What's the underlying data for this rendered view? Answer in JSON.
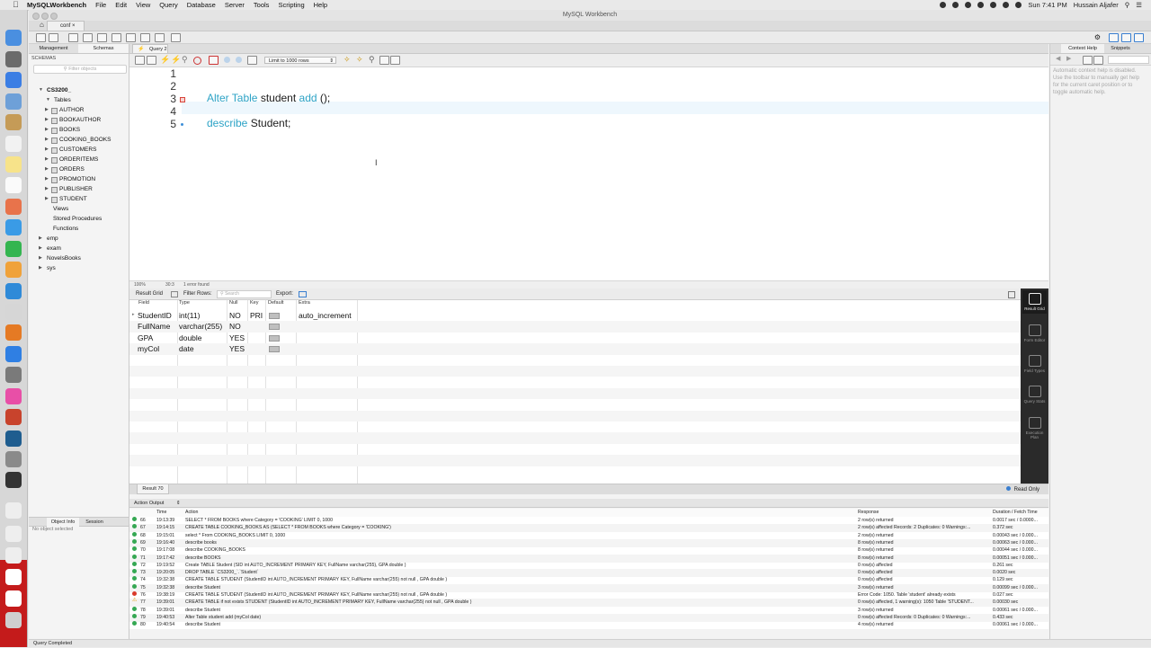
{
  "menubar": {
    "app": "MySQLWorkbench",
    "items": [
      "File",
      "Edit",
      "View",
      "Query",
      "Database",
      "Server",
      "Tools",
      "Scripting",
      "Help"
    ],
    "clock": "Sun 7:41 PM",
    "user": "Hussain Aljafer"
  },
  "window": {
    "title": "MySQL Workbench",
    "connection_tab": "conf"
  },
  "sidebar": {
    "tabs": [
      "Management",
      "Schemas"
    ],
    "header": "SCHEMAS",
    "filter_placeholder": "Filter objects",
    "schema": "CS3200_",
    "tables_label": "Tables",
    "tables": [
      "AUTHOR",
      "BOOKAUTHOR",
      "BOOKS",
      "COOKING_BOOKS",
      "CUSTOMERS",
      "ORDERITEMS",
      "ORDERS",
      "PROMOTION",
      "PUBLISHER",
      "STUDENT"
    ],
    "views": "Views",
    "procedures": "Stored Procedures",
    "functions": "Functions",
    "other_schemas": [
      "emp",
      "exam",
      "NovelsBooks",
      "sys"
    ],
    "bottom_tabs": [
      "Object Info",
      "Session"
    ],
    "no_object": "No object selected"
  },
  "editor": {
    "tab": "Query 2",
    "limit": "Limit to 1000 rows",
    "lines": [
      "1",
      "2",
      "3",
      "4",
      "5"
    ],
    "line3": {
      "kw1": "Alter Table",
      "t1": " student ",
      "kw2": "add",
      "t2": " ();"
    },
    "line5": {
      "kw1": "describe",
      "t1": " Student;"
    },
    "status_zoom": "100%",
    "status_pos": "30:3",
    "status_err": "1 error found"
  },
  "result": {
    "toolbar": {
      "grid": "Result Grid",
      "filter": "Filter Rows:",
      "search": "Search",
      "export": "Export:"
    },
    "headers": [
      "Field",
      "Type",
      "Null",
      "Key",
      "Default",
      "Extra"
    ],
    "rows": [
      {
        "field": "StudentID",
        "type": "int(11)",
        "null": "NO",
        "key": "PRI",
        "extra": "auto_increment"
      },
      {
        "field": "FullName",
        "type": "varchar(255)",
        "null": "NO",
        "key": "",
        "extra": ""
      },
      {
        "field": "GPA",
        "type": "double",
        "null": "YES",
        "key": "",
        "extra": ""
      },
      {
        "field": "myCol",
        "type": "date",
        "null": "YES",
        "key": "",
        "extra": ""
      }
    ],
    "side_buttons": [
      "Result Grid",
      "Form Editor",
      "Field Types",
      "Query Stats",
      "Execution Plan"
    ],
    "tab": "Result 70",
    "read_only": "Read Only"
  },
  "output": {
    "header": "Action Output",
    "columns": [
      "",
      "Time",
      "Action",
      "Response",
      "Duration / Fetch Time"
    ],
    "rows": [
      {
        "s": "ok",
        "n": "66",
        "t": "19:13:39",
        "a": "SELECT * FROM BOOKS where Category = 'COOKING' LIMIT 0, 1000",
        "r": "2 row(s) returned",
        "d": "0.0017 sec / 0.0000..."
      },
      {
        "s": "ok",
        "n": "67",
        "t": "19:14:15",
        "a": "CREATE TABLE COOKING_BOOKS AS (SELECT * FROM BOOKS where Category = 'COOKING')",
        "r": "2 row(s) affected Records: 2  Duplicates: 0  Warnings:...",
        "d": "0.372 sec"
      },
      {
        "s": "ok",
        "n": "68",
        "t": "19:15:01",
        "a": "select * From COOKING_BOOKS LIMIT 0, 1000",
        "r": "2 row(s) returned",
        "d": "0.00043 sec / 0.000..."
      },
      {
        "s": "ok",
        "n": "69",
        "t": "19:16:40",
        "a": "describe books",
        "r": "8 row(s) returned",
        "d": "0.00063 sec / 0.000..."
      },
      {
        "s": "ok",
        "n": "70",
        "t": "19:17:08",
        "a": "describe COOKING_BOOKS",
        "r": "8 row(s) returned",
        "d": "0.00044 sec / 0.000..."
      },
      {
        "s": "ok",
        "n": "71",
        "t": "19:17:42",
        "a": "describe BOOKS",
        "r": "8 row(s) returned",
        "d": "0.00051 sec / 0.000..."
      },
      {
        "s": "ok",
        "n": "72",
        "t": "19:19:52",
        "a": "Create TABLE Student (SID int AUTO_INCREMENT PRIMARY KEY, FullName varchar(255), GPA double )",
        "r": "0 row(s) affected",
        "d": "0.261 sec"
      },
      {
        "s": "ok",
        "n": "73",
        "t": "19:20:05",
        "a": "DROP TABLE `CS3200_`.`Student`",
        "r": "0 row(s) affected",
        "d": "0.0020 sec"
      },
      {
        "s": "ok",
        "n": "74",
        "t": "19:32:38",
        "a": "CREATE TABLE STUDENT (StudentID int AUTO_INCREMENT PRIMARY KEY, FullName varchar(255) not null , GPA double )",
        "r": "0 row(s) affected",
        "d": "0.129 sec"
      },
      {
        "s": "ok",
        "n": "75",
        "t": "19:32:38",
        "a": "describe Student",
        "r": "3 row(s) returned",
        "d": "0.00099 sec / 0.000..."
      },
      {
        "s": "err",
        "n": "76",
        "t": "19:38:19",
        "a": "CREATE TABLE STUDENT (StudentID int AUTO_INCREMENT PRIMARY KEY, FullName varchar(255) not null , GPA double )",
        "r": "Error Code: 1050. Table 'student' already exists",
        "d": "0.027 sec"
      },
      {
        "s": "warn",
        "n": "77",
        "t": "19:39:01",
        "a": "CREATE TABLE if not exists STUDENT (StudentID int AUTO_INCREMENT PRIMARY KEY, FullName varchar(255) not null , GPA double )",
        "r": "0 row(s) affected, 1 warning(s): 1050 Table 'STUDENT...",
        "d": "0.00030 sec"
      },
      {
        "s": "ok",
        "n": "78",
        "t": "19:39:01",
        "a": "describe Student",
        "r": "3 row(s) returned",
        "d": "0.00061 sec / 0.000..."
      },
      {
        "s": "ok",
        "n": "79",
        "t": "19:40:53",
        "a": "Alter Table student add (myCol date)",
        "r": "0 row(s) affected Records: 0  Duplicates: 0  Warnings:...",
        "d": "0.433 sec"
      },
      {
        "s": "ok",
        "n": "80",
        "t": "19:40:54",
        "a": "describe Student",
        "r": "4 row(s) returned",
        "d": "0.00061 sec / 0.000..."
      }
    ]
  },
  "right_panel": {
    "tabs": [
      "Context Help",
      "Snippets"
    ],
    "help": "Automatic context help is disabled. Use the toolbar to manually get help for the current caret position or to toggle automatic help."
  },
  "status_bar": "Query Completed"
}
